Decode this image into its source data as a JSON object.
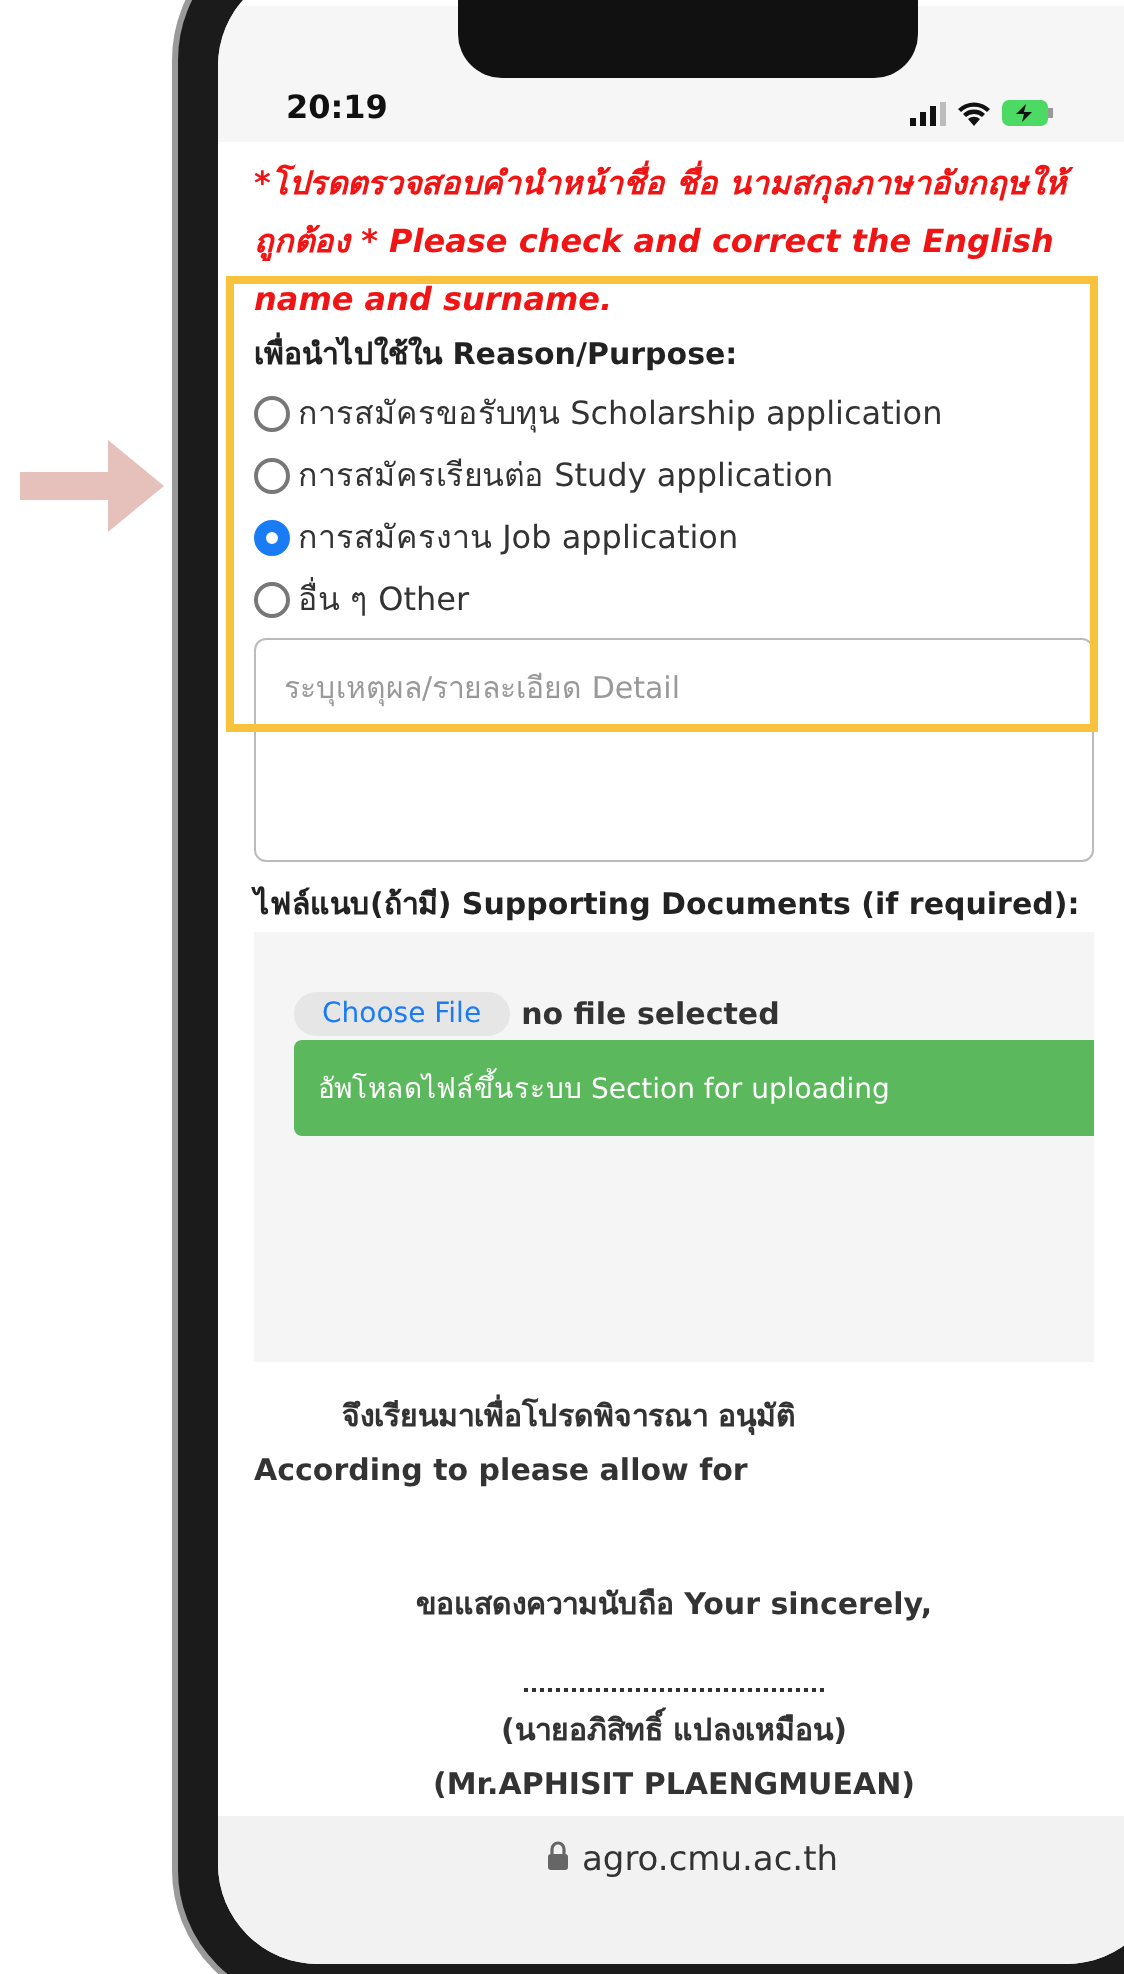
{
  "status_bar": {
    "time": "20:19"
  },
  "notice": "*โปรดตรวจสอบคำนำหน้าชื่อ ชื่อ นามสกุลภาษาอังกฤษให้ถูกต้อง * Please check and correct the English name and surname.",
  "purpose": {
    "label": "เพื่อนำไปใช้ใน Reason/Purpose:",
    "options": [
      {
        "label": "การสมัครขอรับทุน Scholarship application",
        "selected": false
      },
      {
        "label": "การสมัครเรียนต่อ Study application",
        "selected": false
      },
      {
        "label": "การสมัครงาน Job application",
        "selected": true
      },
      {
        "label": "อื่น ๆ Other",
        "selected": false
      }
    ],
    "detail_placeholder": "ระบุเหตุผล/รายละเอียด Detail"
  },
  "attachments": {
    "label": "ไฟล์แนบ(ถ้ามี) Supporting Documents (if required):",
    "choose_button": "Choose File",
    "file_status": "no file selected",
    "upload_button": "อัพโหลดไฟล์ขึ้นระบบ Section for uploading"
  },
  "closing": {
    "request_th": "จึงเรียนมาเพื่อโปรดพิจารณา อนุมัติ",
    "request_en": "According to please allow for",
    "regards": "ขอแสดงความนับถือ Your sincerely,",
    "name_th": "(นายอภิสิทธิ์ แปลงเหมือน)",
    "name_en": "(Mr.APHISIT PLAENGMUEAN)"
  },
  "browser": {
    "url": "agro.cmu.ac.th"
  }
}
